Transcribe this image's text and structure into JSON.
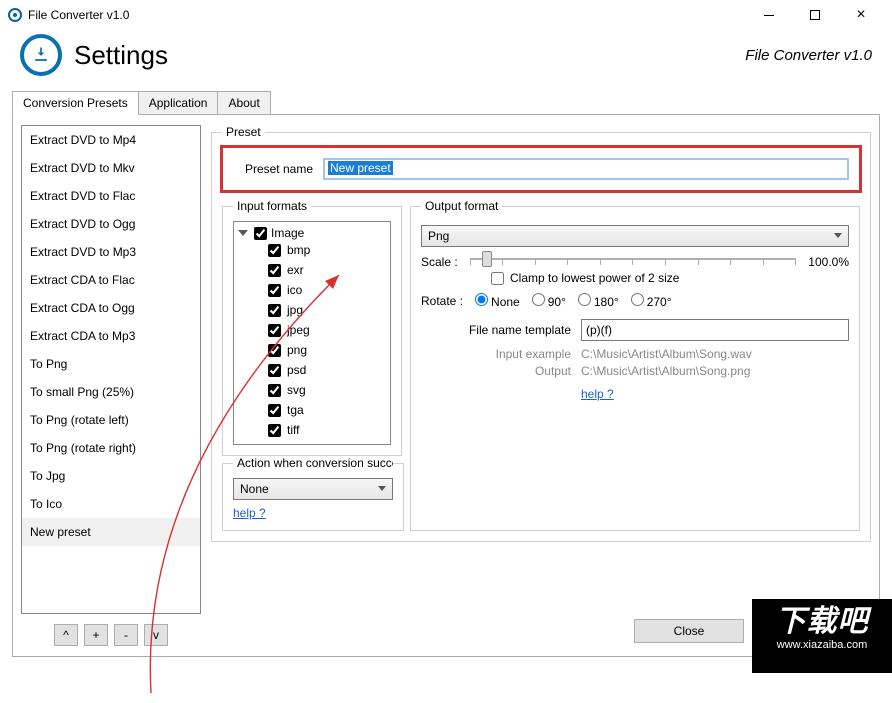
{
  "titlebar": {
    "title": "File Converter v1.0"
  },
  "header": {
    "title": "Settings",
    "brand": "File Converter v1.0"
  },
  "tabs": {
    "t0": "Conversion Presets",
    "t1": "Application",
    "t2": "About"
  },
  "presets": {
    "items": [
      "Extract DVD to Mp4",
      "Extract DVD to Mkv",
      "Extract DVD to Flac",
      "Extract DVD to Ogg",
      "Extract DVD to Mp3",
      "Extract CDA to Flac",
      "Extract CDA to Ogg",
      "Extract CDA to Mp3",
      "To Png",
      "To small Png (25%)",
      "To Png (rotate left)",
      "To Png (rotate right)",
      "To Jpg",
      "To Ico",
      "New preset"
    ],
    "buttons": {
      "up": "^",
      "add": "+",
      "remove": "-",
      "down": "v"
    },
    "selected_index": 14
  },
  "preset_panel": {
    "legend": "Preset",
    "name_label": "Preset name",
    "name_value": "New preset"
  },
  "input_formats": {
    "legend": "Input formats",
    "root": "Image",
    "children": [
      "bmp",
      "exr",
      "ico",
      "jpg",
      "jpeg",
      "png",
      "psd",
      "svg",
      "tga",
      "tiff"
    ]
  },
  "action": {
    "legend": "Action when conversion succeed",
    "value": "None",
    "help": "help ?"
  },
  "output": {
    "legend": "Output format",
    "format": "Png",
    "scale_label": "Scale :",
    "scale_value": "100.0%",
    "clamp_label": "Clamp to lowest power of 2 size",
    "rotate_label": "Rotate :",
    "rotate_options": {
      "r0": "None",
      "r1": "90°",
      "r2": "180°",
      "r3": "270°"
    },
    "template_label": "File name template",
    "template_value": "(p)(f)",
    "example_label": "Input example",
    "example_value": "C:\\Music\\Artist\\Album\\Song.wav",
    "output_label": "Output",
    "output_value": "C:\\Music\\Artist\\Album\\Song.png",
    "help": "help ?"
  },
  "close": "Close",
  "watermark": {
    "big": "下载吧",
    "url": "www.xiazaiba.com"
  }
}
